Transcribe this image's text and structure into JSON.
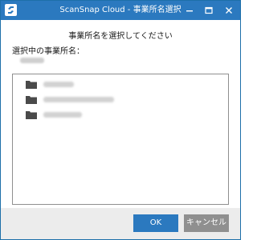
{
  "window": {
    "title": "ScanSnap Cloud - 事業所名選択"
  },
  "dialog": {
    "heading": "事業所名を選択してください",
    "selected_label": "選択中の事業所名："
  },
  "office_list": {
    "item_count_visible": 3
  },
  "buttons": {
    "ok_label": "OK",
    "cancel_label": "キャンセル"
  },
  "colors": {
    "titlebar": "#2b79bf",
    "ok_button": "#2b79bf",
    "cancel_button": "#8f8f8f",
    "folder": "#4a4a4a"
  }
}
